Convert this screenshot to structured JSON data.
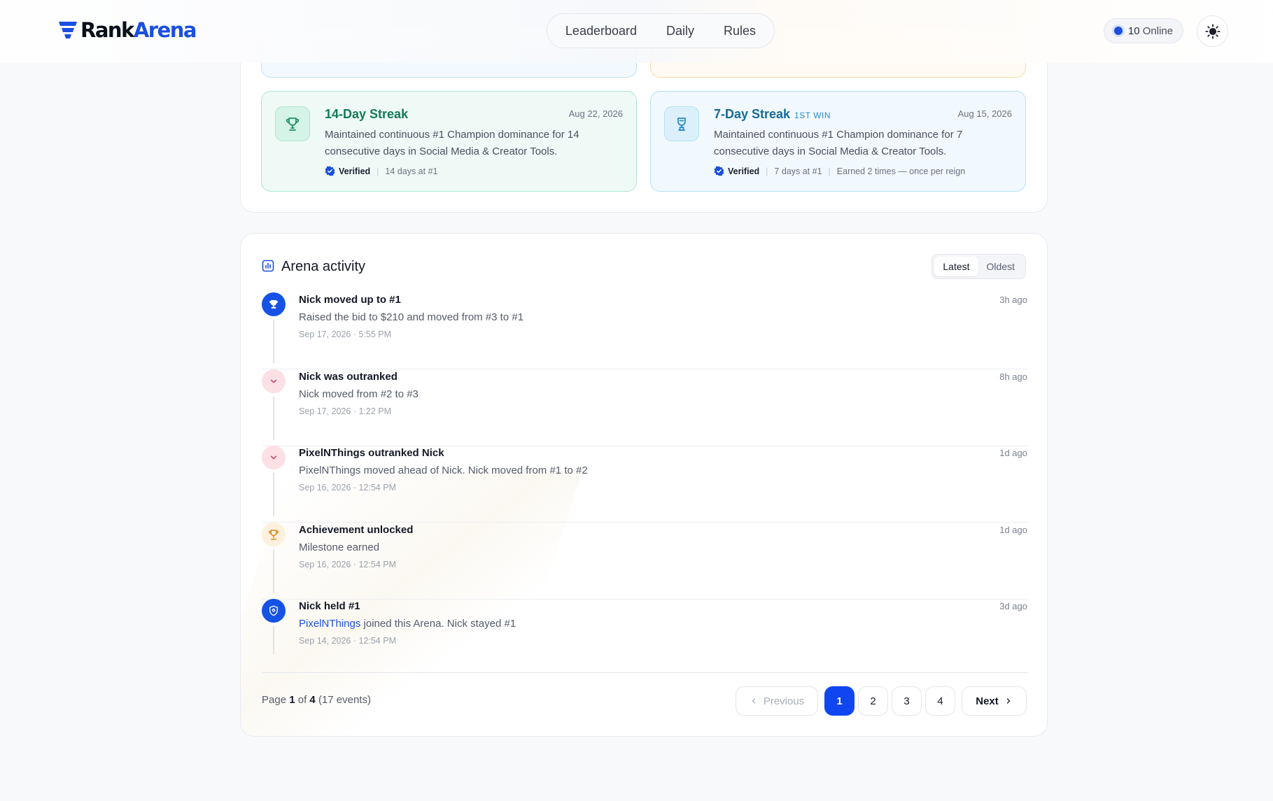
{
  "header": {
    "logo": {
      "rank": "Rank",
      "arena": "Arena"
    },
    "nav": [
      "Leaderboard",
      "Daily",
      "Rules"
    ],
    "online": {
      "count": "10",
      "label": "Online"
    }
  },
  "achievements": [
    {
      "title": "14-Day Streak",
      "badge": "",
      "date": "Aug 22, 2026",
      "desc": "Maintained continuous #1 Champion dominance for 14 consecutive days in Social Media & Creator Tools.",
      "verified": "Verified",
      "meta1": "14 days at #1",
      "meta2": ""
    },
    {
      "title": "7-Day Streak",
      "badge": "1ST WIN",
      "date": "Aug 15, 2026",
      "desc": "Maintained continuous #1 Champion dominance for 7 consecutive days in Social Media & Creator Tools.",
      "verified": "Verified",
      "meta1": "7 days at #1",
      "meta2": "Earned 2 times — once per reign"
    }
  ],
  "activity": {
    "title": "Arena activity",
    "sort": [
      "Latest",
      "Oldest"
    ],
    "events": [
      {
        "title": "Nick moved up to #1",
        "desc": "Raised the bid to $210 and moved from #3 to #1",
        "link": "",
        "time": "Sep 17, 2026 · 5:55 PM",
        "ago": "3h ago",
        "icon": "trophy-icon"
      },
      {
        "title": "Nick was outranked",
        "desc": "Nick moved from #2 to #3",
        "link": "",
        "time": "Sep 17, 2026 · 1:22 PM",
        "ago": "8h ago",
        "icon": "chevron-down-icon"
      },
      {
        "title": "PixelNThings outranked Nick",
        "desc": "PixelNThings moved ahead of Nick. Nick moved from #1 to #2",
        "link": "",
        "time": "Sep 16, 2026 · 12:54 PM",
        "ago": "1d ago",
        "icon": "chevron-down-icon"
      },
      {
        "title": "Achievement unlocked",
        "desc": "Milestone earned",
        "link": "",
        "time": "Sep 16, 2026 · 12:54 PM",
        "ago": "1d ago",
        "icon": "trophy-icon"
      },
      {
        "title": "Nick held #1",
        "desc": " joined this Arena. Nick stayed #1",
        "link": "PixelNThings",
        "time": "Sep 14, 2026 · 12:54 PM",
        "ago": "3d ago",
        "icon": "shield-icon"
      }
    ],
    "pagination": {
      "page_label": "Page",
      "current": "1",
      "of_label": "of",
      "total": "4",
      "events": "(17 events)",
      "prev": "Previous",
      "next": "Next",
      "pages": [
        "1",
        "2",
        "3",
        "4"
      ]
    }
  },
  "colors": {
    "brand": "#1a4fe0",
    "accent": "#1046f0"
  }
}
